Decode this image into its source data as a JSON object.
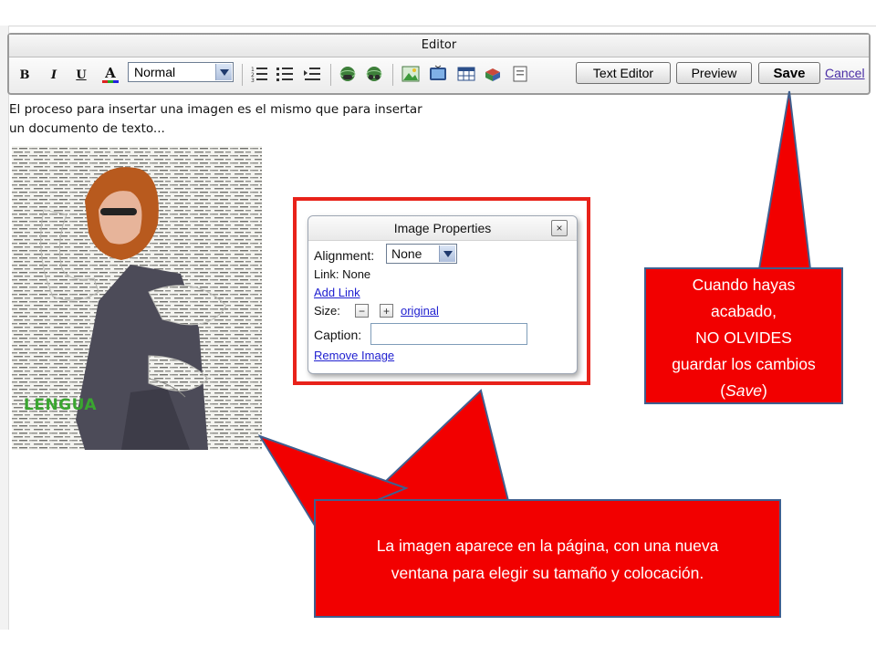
{
  "editor": {
    "title": "Editor",
    "toolbar": {
      "bold_label": "B",
      "italic_label": "I",
      "underline_label": "U",
      "text_color_label": "A",
      "format_value": "Normal",
      "text_editor_label": "Text Editor",
      "preview_label": "Preview",
      "save_label": "Save",
      "cancel_label": "Cancel",
      "icons": [
        "bold-icon",
        "italic-icon",
        "underline-icon",
        "text-color-icon",
        "numbered-list-icon",
        "bulleted-list-icon",
        "outdent-icon",
        "insert-link-icon",
        "remove-link-icon",
        "insert-image-icon",
        "insert-video-icon",
        "insert-table-icon",
        "insert-widget-icon",
        "insert-file-icon"
      ]
    }
  },
  "content": {
    "intro_text": "El proceso para insertar una imagen es el mismo que para insertar un documento de texto...",
    "image_caption_overlay": "LENGUA"
  },
  "image_properties": {
    "title": "Image Properties",
    "alignment_label": "Alignment:",
    "alignment_value": "None",
    "link_text": "Link: None",
    "add_link_label": "Add Link",
    "size_label": "Size:",
    "size_decrease": "−",
    "size_increase": "+",
    "size_original_label": "original",
    "caption_label": "Caption:",
    "caption_value": "",
    "remove_image_label": "Remove Image",
    "close_label": "×"
  },
  "callouts": {
    "save_note": {
      "line1": "Cuando hayas",
      "line2": "acabado,",
      "line3": "NO OLVIDES",
      "line4": "guardar los cambios",
      "line5_open": "(",
      "line5_emph": "Save",
      "line5_close": ")"
    },
    "image_note": {
      "line1": "La imagen aparece en la página, con una nueva",
      "line2": "ventana para elegir su tamaño y colocación."
    },
    "colors": {
      "callout_fill": "#f20000",
      "callout_border": "#3f5f8f",
      "highlight_outline": "#e8221a"
    }
  }
}
